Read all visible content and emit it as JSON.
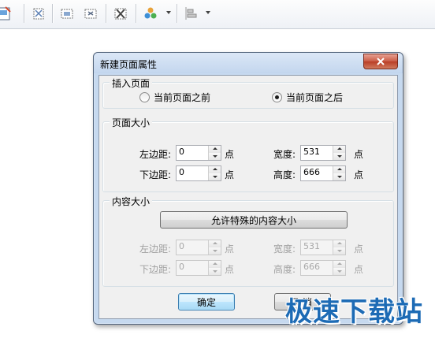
{
  "toolbar": {
    "icons": [
      "edit-page-icon",
      "rotate-page-icon",
      "crop-page-icon",
      "extract-page-icon",
      "delete-page-icon",
      "color-shapes-icon",
      "align-icon"
    ]
  },
  "dialog": {
    "title": "新建页面属性",
    "insert_group": {
      "legend": "插入页面",
      "option_before": "当前页面之前",
      "option_after": "当前页面之后",
      "selected": "after"
    },
    "page_size_group": {
      "legend": "页面大小",
      "left_margin_label": "左边距:",
      "left_margin_value": "0",
      "bottom_margin_label": "下边距:",
      "bottom_margin_value": "0",
      "width_label": "宽度:",
      "width_value": "531",
      "height_label": "高度:",
      "height_value": "666",
      "unit": "点"
    },
    "content_size_group": {
      "legend": "内容大小",
      "allow_button": "允许特殊的内容大小",
      "left_margin_label": "左边距:",
      "left_margin_value": "0",
      "bottom_margin_label": "下边距:",
      "bottom_margin_value": "0",
      "width_label": "宽度:",
      "width_value": "531",
      "height_label": "高度:",
      "height_value": "666",
      "unit": "点"
    },
    "ok_button": "确定",
    "cancel_button": "取消"
  },
  "watermark": "极速下载站",
  "colors": {
    "dialog_frame": "#c6d9ef",
    "close_button": "#c95a44",
    "watermark": "#1d6bb5"
  }
}
